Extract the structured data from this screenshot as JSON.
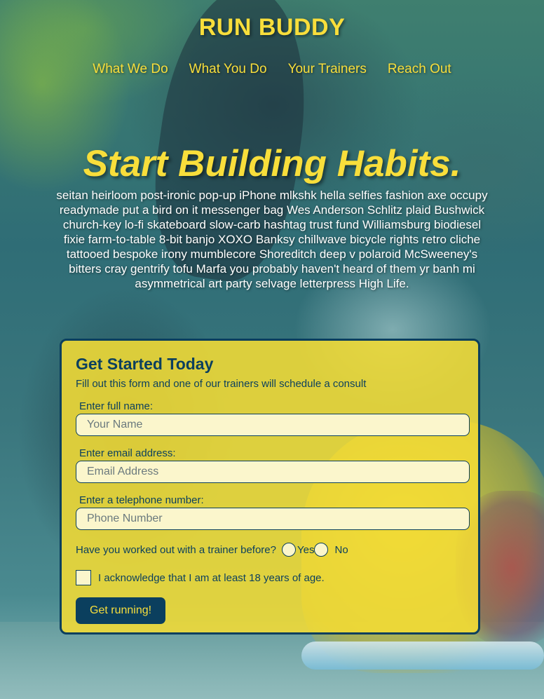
{
  "brand": "RUN BUDDY",
  "nav": {
    "items": [
      "What We Do",
      "What You Do",
      "Your Trainers",
      "Reach Out"
    ]
  },
  "hero": {
    "title": "Start Building Habits.",
    "text": "seitan heirloom post-ironic pop-up iPhone mlkshk hella selfies fashion axe occupy readymade put a bird on it messenger bag Wes Anderson Schlitz plaid Bushwick church-key lo-fi skateboard slow-carb hashtag trust fund Williamsburg biodiesel fixie farm-to-table 8-bit banjo XOXO Banksy chillwave bicycle rights retro cliche tattooed bespoke irony mumblecore Shoreditch deep v polaroid McSweeney's bitters cray gentrify tofu Marfa you probably haven't heard of them yr banh mi asymmetrical art party selvage letterpress High Life."
  },
  "form": {
    "title": "Get Started Today",
    "subtitle": "Fill out this form and one of our trainers will schedule a consult",
    "name_label": "Enter full name:",
    "name_placeholder": "Your Name",
    "email_label": "Enter email address:",
    "email_placeholder": "Email Address",
    "phone_label": "Enter a telephone number:",
    "phone_placeholder": "Phone Number",
    "trainer_question": "Have you worked out with a trainer before?",
    "yes_label": "Yes",
    "no_label": "No",
    "ack_label": "I acknowledge that I am at least 18 years of age.",
    "submit_label": "Get running!"
  },
  "colors": {
    "accent_yellow": "#f8de3b",
    "navy": "#0b3f5e",
    "card_bg": "#f4dc34"
  }
}
